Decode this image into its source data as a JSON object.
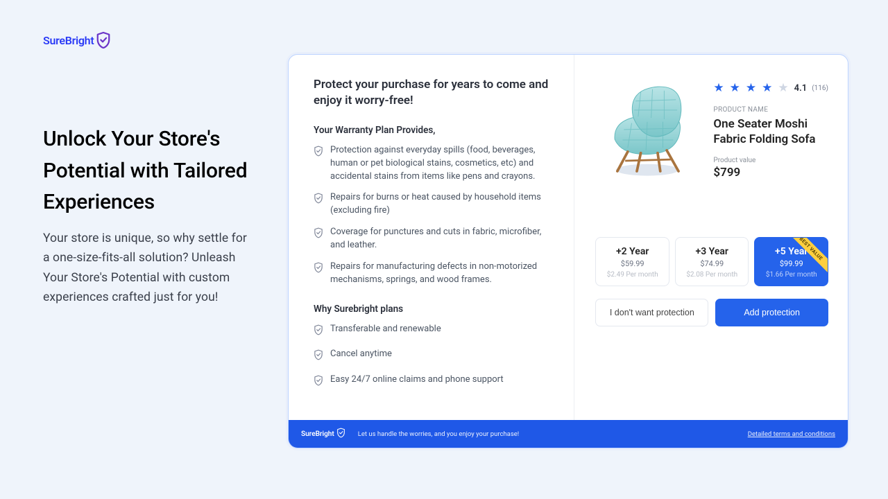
{
  "logo": {
    "text": "SureBright"
  },
  "headline": "Unlock Your Store's Potential with Tailored Experiences",
  "sub": "Your store is unique, so why settle for a one-size-fits-all solution? Unleash Your Store's Potential with custom experiences crafted just for you!",
  "modal": {
    "title": "Protect your purchase for years to come and enjoy it worry-free!",
    "provides_header": "Your Warranty Plan Provides,",
    "provides": [
      "Protection against everyday spills (food, beverages, human or pet biological stains, cosmetics, etc) and accidental stains from items like pens and crayons.",
      "Repairs for burns or heat caused by household items (excluding fire)",
      "Coverage for punctures and cuts in fabric, microfiber, and leather.",
      "Repairs for manufacturing defects in non-motorized mechanisms, springs, and wood frames."
    ],
    "why_header": "Why Surebright plans",
    "why": [
      "Transferable and renewable",
      "Cancel anytime",
      "Easy 24/7 online claims and phone support"
    ],
    "product": {
      "rating": "4.1",
      "rating_count": "(116)",
      "name_label": "PRODUCT NAME",
      "name": "One Seater Moshi Fabric Folding Sofa",
      "value_label": "Product value",
      "price": "$799"
    },
    "plans": [
      {
        "term": "+2 Year",
        "price": "$59.99",
        "per_month": "$2.49 Per month",
        "selected": false,
        "best": false
      },
      {
        "term": "+3 Year",
        "price": "$74.99",
        "per_month": "$2.08 Per month",
        "selected": false,
        "best": false
      },
      {
        "term": "+5 Year",
        "price": "$99.99",
        "per_month": "$1.66 Per month",
        "selected": true,
        "best": true,
        "best_label": "BEST VALUE"
      }
    ],
    "buttons": {
      "decline": "I don't want protection",
      "accept": "Add protection"
    },
    "footer": {
      "logo": "SureBright",
      "tag": "Let us handle the worries, and you enjoy your purchase!",
      "link": "Detailed terms and conditions"
    }
  }
}
